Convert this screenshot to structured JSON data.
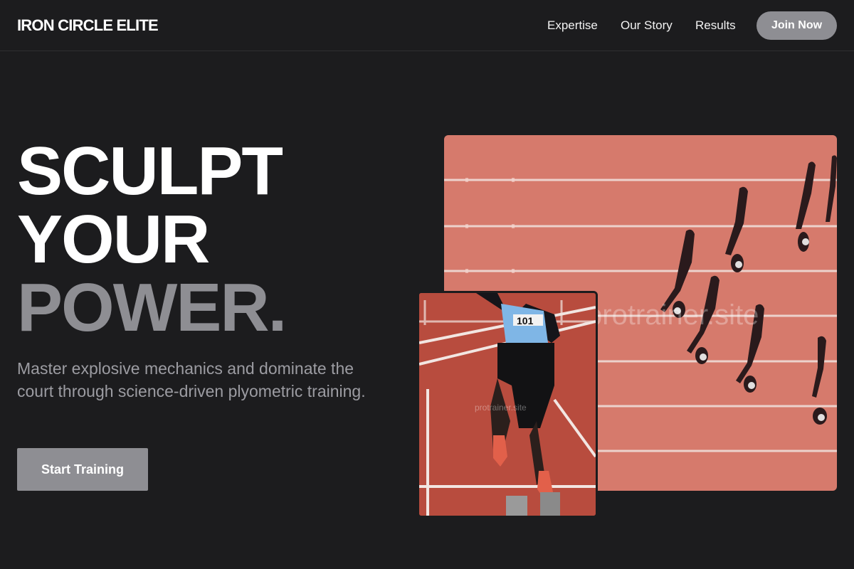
{
  "header": {
    "logo": "IRON CIRCLE ELITE",
    "nav": [
      "Expertise",
      "Our Story",
      "Results"
    ],
    "cta_label": "Join Now"
  },
  "hero": {
    "headline_lines": [
      "SCULPT",
      "YOUR",
      "POWER."
    ],
    "subtext": "Master explosive mechanics and dominate the court through science-driven plyometric training.",
    "cta_label": "Start Training"
  },
  "images": {
    "main_watermark": "protrainer.site",
    "inset_watermark": "protrainer.site",
    "bib_number": "101"
  },
  "colors": {
    "background": "#1c1c1e",
    "accent_gray": "#8e8e93",
    "track": "#d67a6c"
  }
}
